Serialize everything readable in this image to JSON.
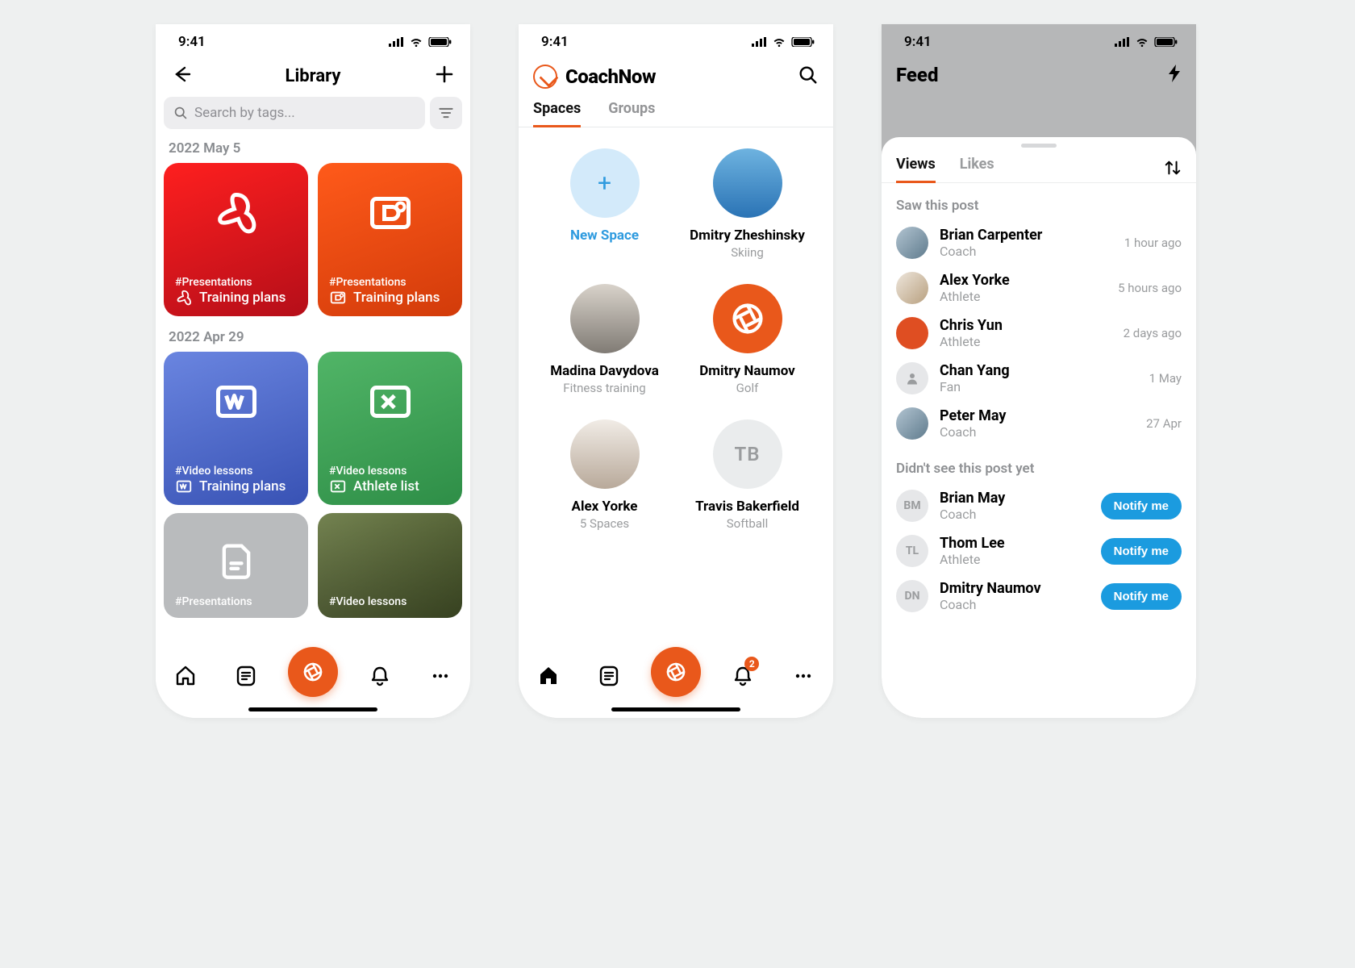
{
  "status": {
    "time": "9:41"
  },
  "library": {
    "title": "Library",
    "search_placeholder": "Search by tags...",
    "dates": {
      "d1": "2022 May 5",
      "d2": "2022 Apr 29"
    },
    "cards": {
      "pdf": {
        "tag": "#Presentations",
        "name": "Training plans"
      },
      "ppt": {
        "tag": "#Presentations",
        "name": "Training plans"
      },
      "word": {
        "tag": "#Video lessons",
        "name": "Training plans"
      },
      "xls": {
        "tag": "#Video lessons",
        "name": "Athlete list"
      },
      "grey": {
        "tag": "#Presentations"
      },
      "photo": {
        "tag": "#Video lessons"
      }
    }
  },
  "spaces": {
    "brand": "CoachNow",
    "tabs": {
      "spaces": "Spaces",
      "groups": "Groups"
    },
    "new_space": "New Space",
    "items": [
      {
        "name": "Dmitry Zheshinsky",
        "sub": "Skiing"
      },
      {
        "name": "Madina Davydova",
        "sub": "Fitness training"
      },
      {
        "name": "Dmitry Naumov",
        "sub": "Golf"
      },
      {
        "name": "Alex Yorke",
        "sub": "5 Spaces"
      },
      {
        "name": "Travis Bakerfield",
        "sub": "Softball",
        "initials": "TB"
      }
    ],
    "badge": "2"
  },
  "feed": {
    "title": "Feed",
    "tabs": {
      "views": "Views",
      "likes": "Likes"
    },
    "section_saw": "Saw this post",
    "section_not": "Didn't see this post yet",
    "saw": [
      {
        "name": "Brian Carpenter",
        "role": "Coach",
        "time": "1 hour ago"
      },
      {
        "name": "Alex Yorke",
        "role": "Athlete",
        "time": "5 hours ago"
      },
      {
        "name": "Chris Yun",
        "role": "Athlete",
        "time": "2 days ago"
      },
      {
        "name": "Chan Yang",
        "role": "Fan",
        "time": "1 May"
      },
      {
        "name": "Peter May",
        "role": "Coach",
        "time": "27 Apr"
      }
    ],
    "notseen": [
      {
        "name": "Brian May",
        "role": "Coach",
        "initials": "BM"
      },
      {
        "name": "Thom Lee",
        "role": "Athlete",
        "initials": "TL"
      },
      {
        "name": "Dmitry Naumov",
        "role": "Coach",
        "initials": "DN"
      }
    ],
    "notify_label": "Notify me"
  }
}
